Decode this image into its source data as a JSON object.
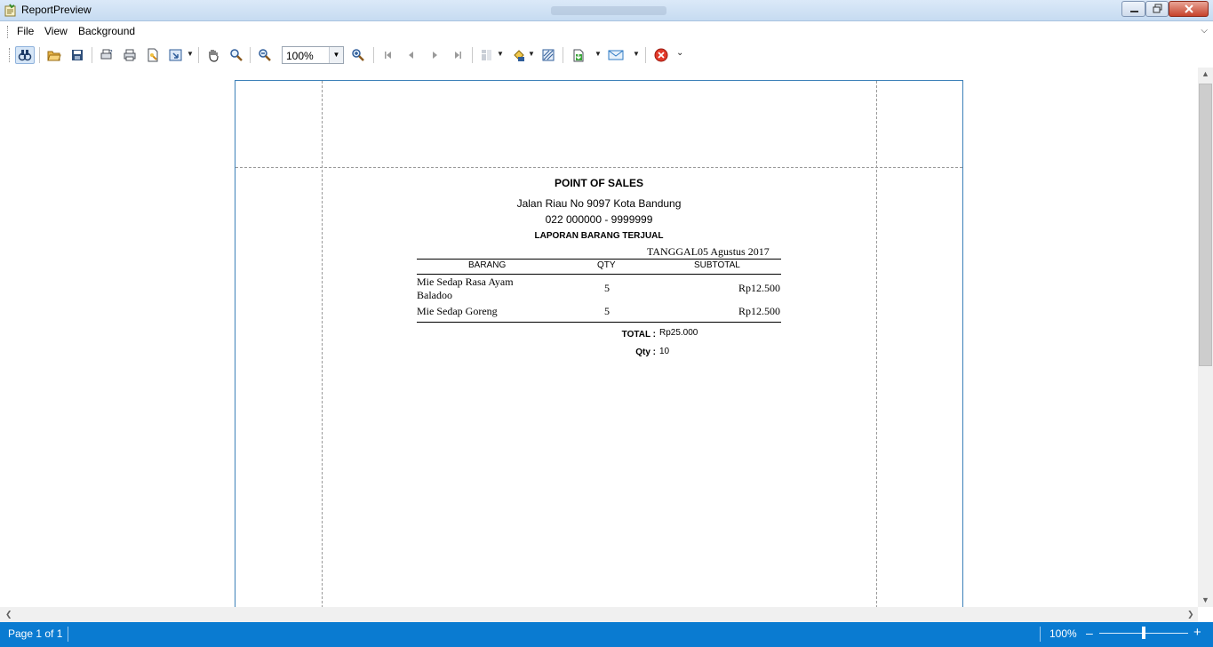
{
  "window": {
    "title": "ReportPreview",
    "colors": {
      "titlebar": "#c6dbf1",
      "statusbar": "#0a7bd1",
      "page_border": "#3c80b8",
      "close_button": "#c7432b"
    }
  },
  "menu": {
    "items": [
      {
        "label": "File"
      },
      {
        "label": "View"
      },
      {
        "label": "Background"
      }
    ]
  },
  "toolbar": {
    "zoom_value": "100%",
    "icons": [
      "search-icon",
      "open-icon",
      "save-icon",
      "print-setup-icon",
      "print-icon",
      "page-setup-icon",
      "scale-icon",
      "hand-tool-icon",
      "magnifier-icon",
      "zoom-out-icon",
      "zoom-in-icon",
      "first-page-icon",
      "previous-page-icon",
      "next-page-icon",
      "last-page-icon",
      "multiple-pages-icon",
      "fill-color-icon",
      "watermark-icon",
      "export-icon",
      "email-icon",
      "close-preview-icon"
    ]
  },
  "report": {
    "title": "POINT OF SALES",
    "address": "Jalan Riau No 9097 Kota Bandung",
    "phone": "022 000000 - 9999999",
    "subtitle": "LAPORAN BARANG TERJUAL",
    "date_label": "TANGGAL",
    "date_value": "05 Agustus 2017",
    "columns": [
      "BARANG",
      "QTY",
      "SUBTOTAL"
    ],
    "rows": [
      {
        "item_line1": "Mie Sedap Rasa Ayam",
        "item_line2": "Baladoo",
        "qty": "5",
        "subtotal": "Rp12.500"
      },
      {
        "item_line1": "Mie Sedap Goreng",
        "item_line2": "",
        "qty": "5",
        "subtotal": "Rp12.500"
      }
    ],
    "total_label": "TOTAL :",
    "total_value": "Rp25.000",
    "qty_label": "Qty :",
    "qty_value": "10"
  },
  "status": {
    "page_info": "Page 1 of 1",
    "zoom": "100%",
    "zoom_level": 0.5
  }
}
